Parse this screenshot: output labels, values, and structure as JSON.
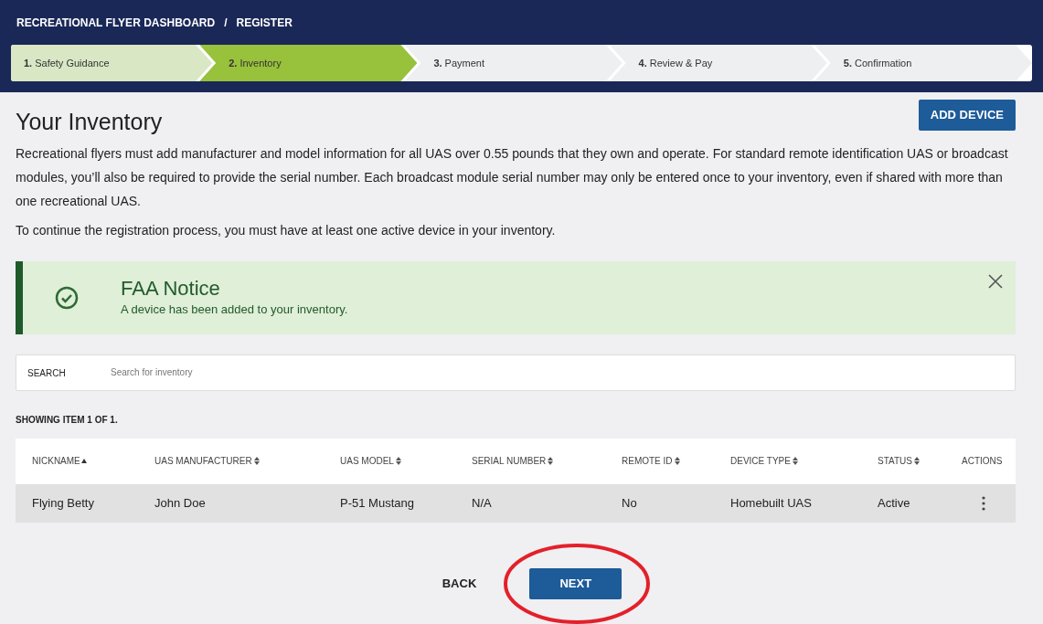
{
  "breadcrumb": [
    "RECREATIONAL FLYER DASHBOARD",
    "REGISTER"
  ],
  "breadcrumb_separator": "/",
  "steps": [
    {
      "number": "1.",
      "label": "Safety Guidance",
      "kind": "done"
    },
    {
      "number": "2.",
      "label": "Inventory",
      "kind": "current"
    },
    {
      "number": "3.",
      "label": "Payment",
      "kind": "upcoming"
    },
    {
      "number": "4.",
      "label": "Review & Pay",
      "kind": "upcoming"
    },
    {
      "number": "5.",
      "label": "Confirmation",
      "kind": "upcoming"
    }
  ],
  "title": "Your Inventory",
  "add_button": "ADD DEVICE",
  "paragraphs": [
    "Recreational flyers must add manufacturer and model information for all UAS over 0.55 pounds that they own and operate. For standard remote identification UAS or broadcast modules, you’ll also be required to provide the serial number. Each broadcast module serial number may only be entered once to your inventory, even if shared with more than one recreational UAS.",
    "To continue the registration process, you must have at least one active device in your inventory."
  ],
  "notice": {
    "title": "FAA Notice",
    "message": "A device has been added to your inventory."
  },
  "search": {
    "label": "SEARCH",
    "placeholder": "Search for inventory"
  },
  "showing": "SHOWING ITEM 1 OF 1.",
  "table": {
    "columns": [
      {
        "label": "NICKNAME",
        "kind": "sorted"
      },
      {
        "label": "UAS MANUFACTURER",
        "kind": "sortable"
      },
      {
        "label": "UAS MODEL",
        "kind": "sortable"
      },
      {
        "label": "SERIAL NUMBER",
        "kind": "sortable"
      },
      {
        "label": "REMOTE ID",
        "kind": "sortable"
      },
      {
        "label": "DEVICE TYPE",
        "kind": "sortable"
      },
      {
        "label": "STATUS",
        "kind": "sortable"
      },
      {
        "label": "ACTIONS",
        "kind": "plain"
      }
    ],
    "rows": [
      {
        "cells": [
          "Flying Betty",
          "John Doe",
          "P-51 Mustang",
          "N/A",
          "No",
          "Homebuilt UAS",
          "Active"
        ]
      }
    ]
  },
  "buttons": {
    "back": "BACK",
    "next": "NEXT"
  }
}
